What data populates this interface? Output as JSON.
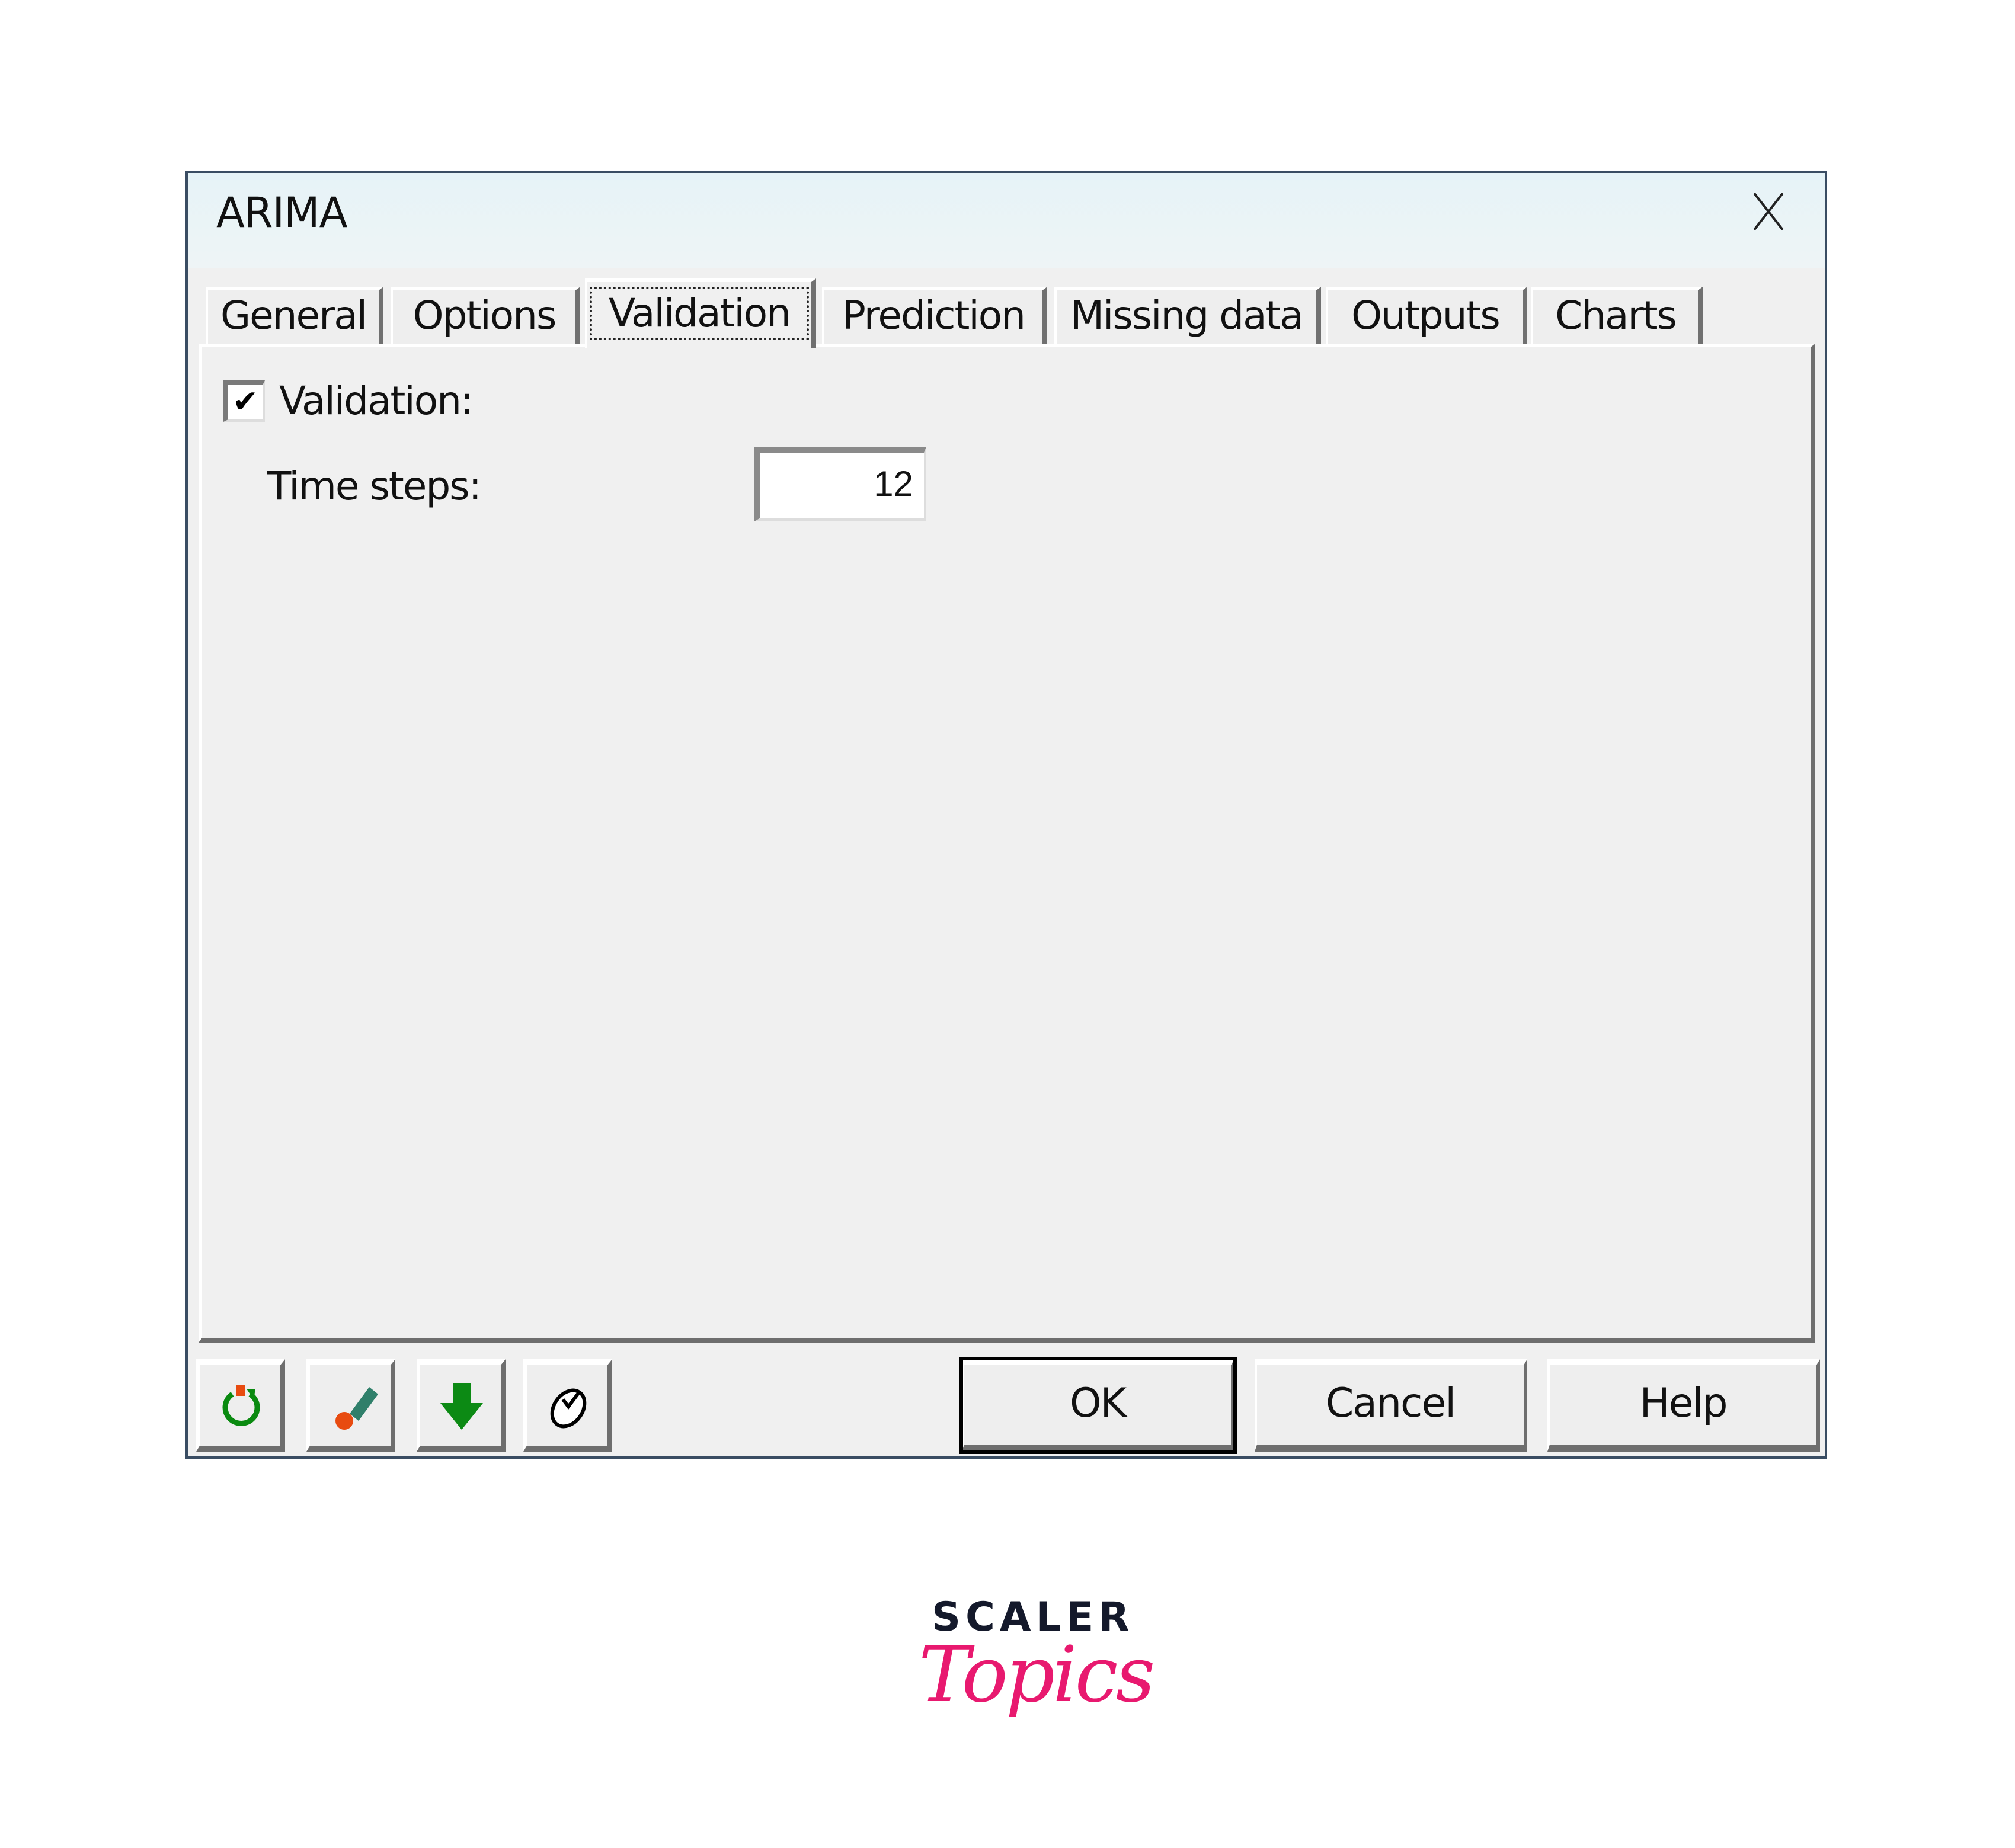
{
  "window": {
    "title": "ARIMA",
    "close_icon": "close-icon"
  },
  "tabs": [
    {
      "label": "General",
      "active": false
    },
    {
      "label": "Options",
      "active": false
    },
    {
      "label": "Validation",
      "active": true
    },
    {
      "label": "Prediction",
      "active": false
    },
    {
      "label": "Missing data",
      "active": false
    },
    {
      "label": "Outputs",
      "active": false
    },
    {
      "label": "Charts",
      "active": false
    }
  ],
  "validation": {
    "checkbox_label": "Validation:",
    "checked": true,
    "check_glyph": "✔",
    "time_steps_label": "Time steps:",
    "time_steps_value": "12"
  },
  "toolbar": {
    "icons": [
      "reset-icon",
      "eraser-icon",
      "down-arrow-icon",
      "mouse-icon"
    ]
  },
  "buttons": {
    "ok": "OK",
    "cancel": "Cancel",
    "help": "Help"
  },
  "branding": {
    "line1": "SCALER",
    "line2": "Topics",
    "accent": "#e8196f",
    "dark": "#14192b"
  }
}
